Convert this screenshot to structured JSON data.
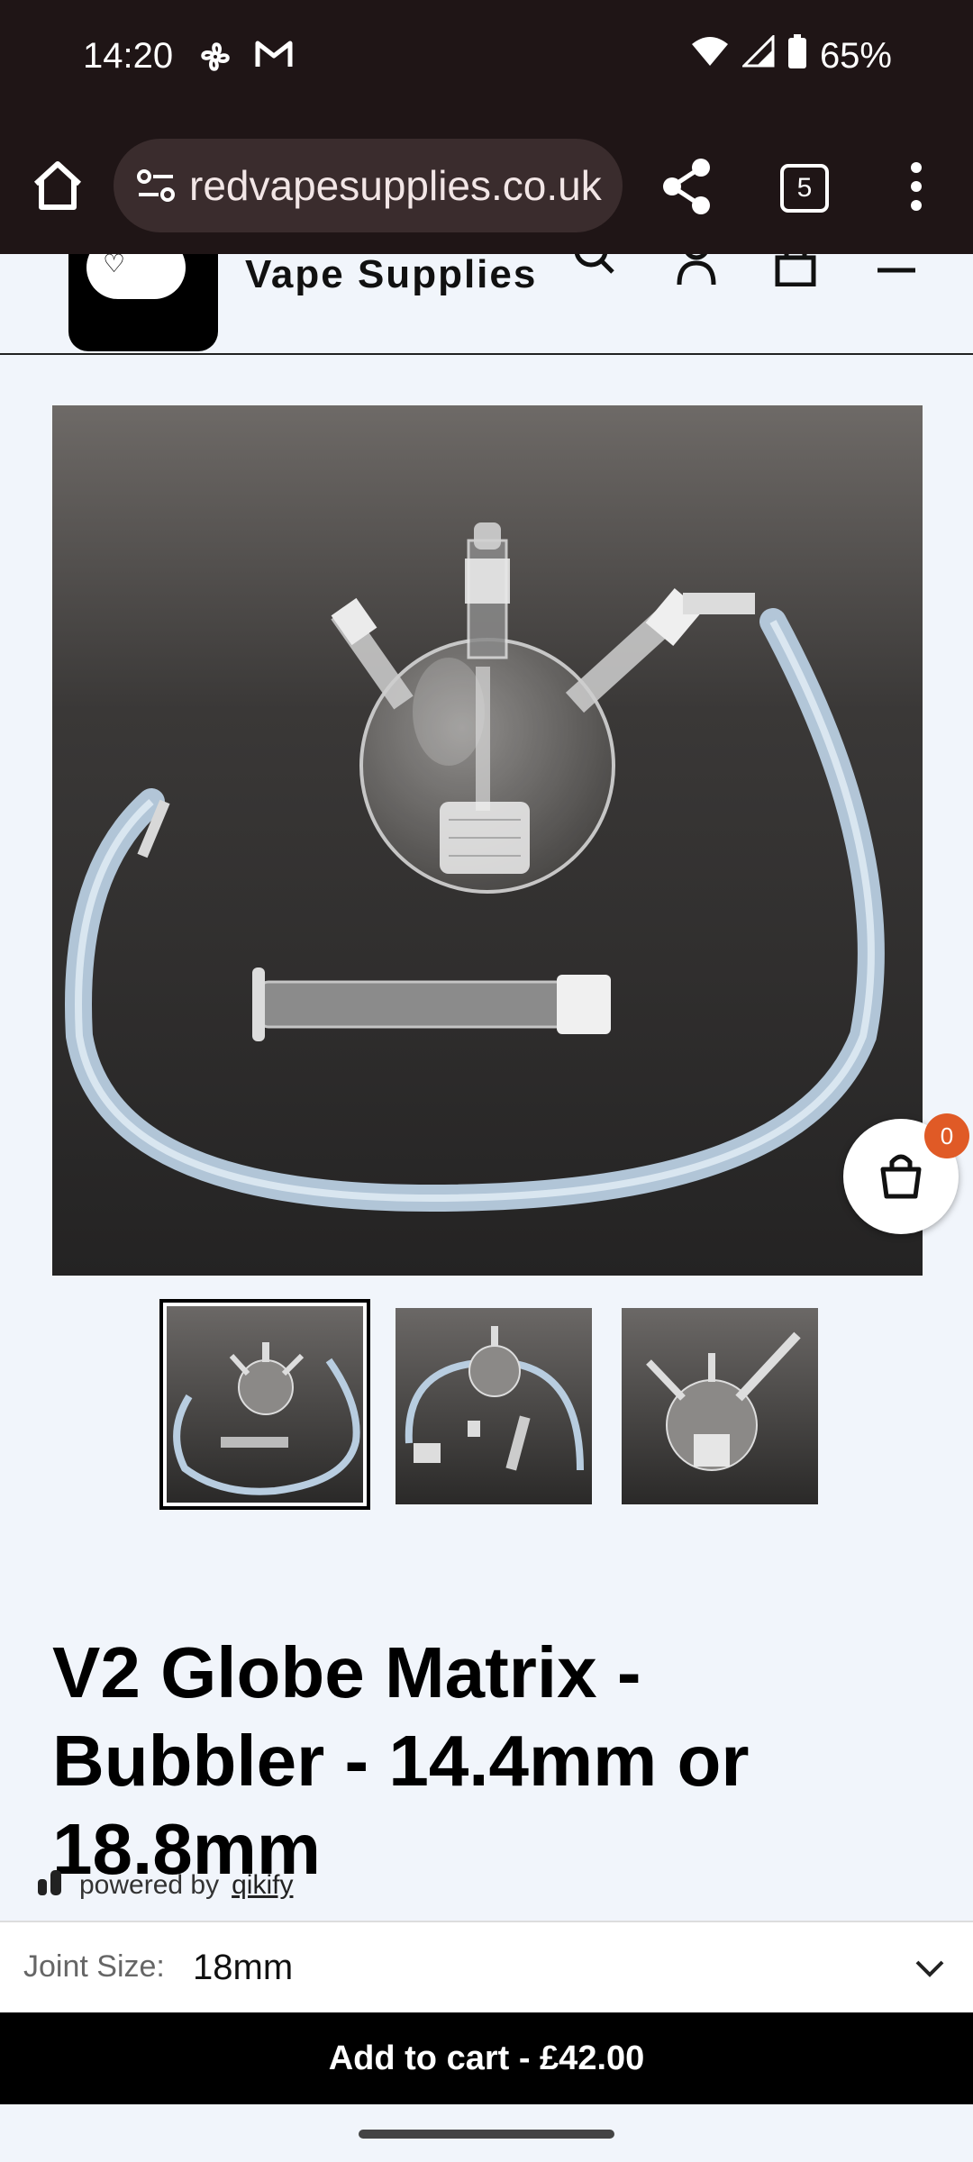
{
  "status_bar": {
    "time": "14:20",
    "battery": "65%",
    "icons": [
      "fan-icon",
      "gmail-icon",
      "wifi-icon",
      "signal-icon",
      "battery-icon"
    ]
  },
  "browser": {
    "url": "redvapesupplies.co.uk",
    "tab_count": "5"
  },
  "site": {
    "brand": "Vape Supplies"
  },
  "product": {
    "title": "V2 Globe Matrix - Bubbler - 14.4mm or 18.8mm",
    "thumbnails": [
      "thumbnail-1",
      "thumbnail-2",
      "thumbnail-3"
    ],
    "selected_thumbnail": 0
  },
  "cart": {
    "count": "0"
  },
  "powered_by": {
    "prefix": "powered by",
    "brand": "qikify"
  },
  "variant": {
    "label": "Joint Size:",
    "value": "18mm"
  },
  "add_to_cart": {
    "label": "Add to cart - £42.00"
  }
}
